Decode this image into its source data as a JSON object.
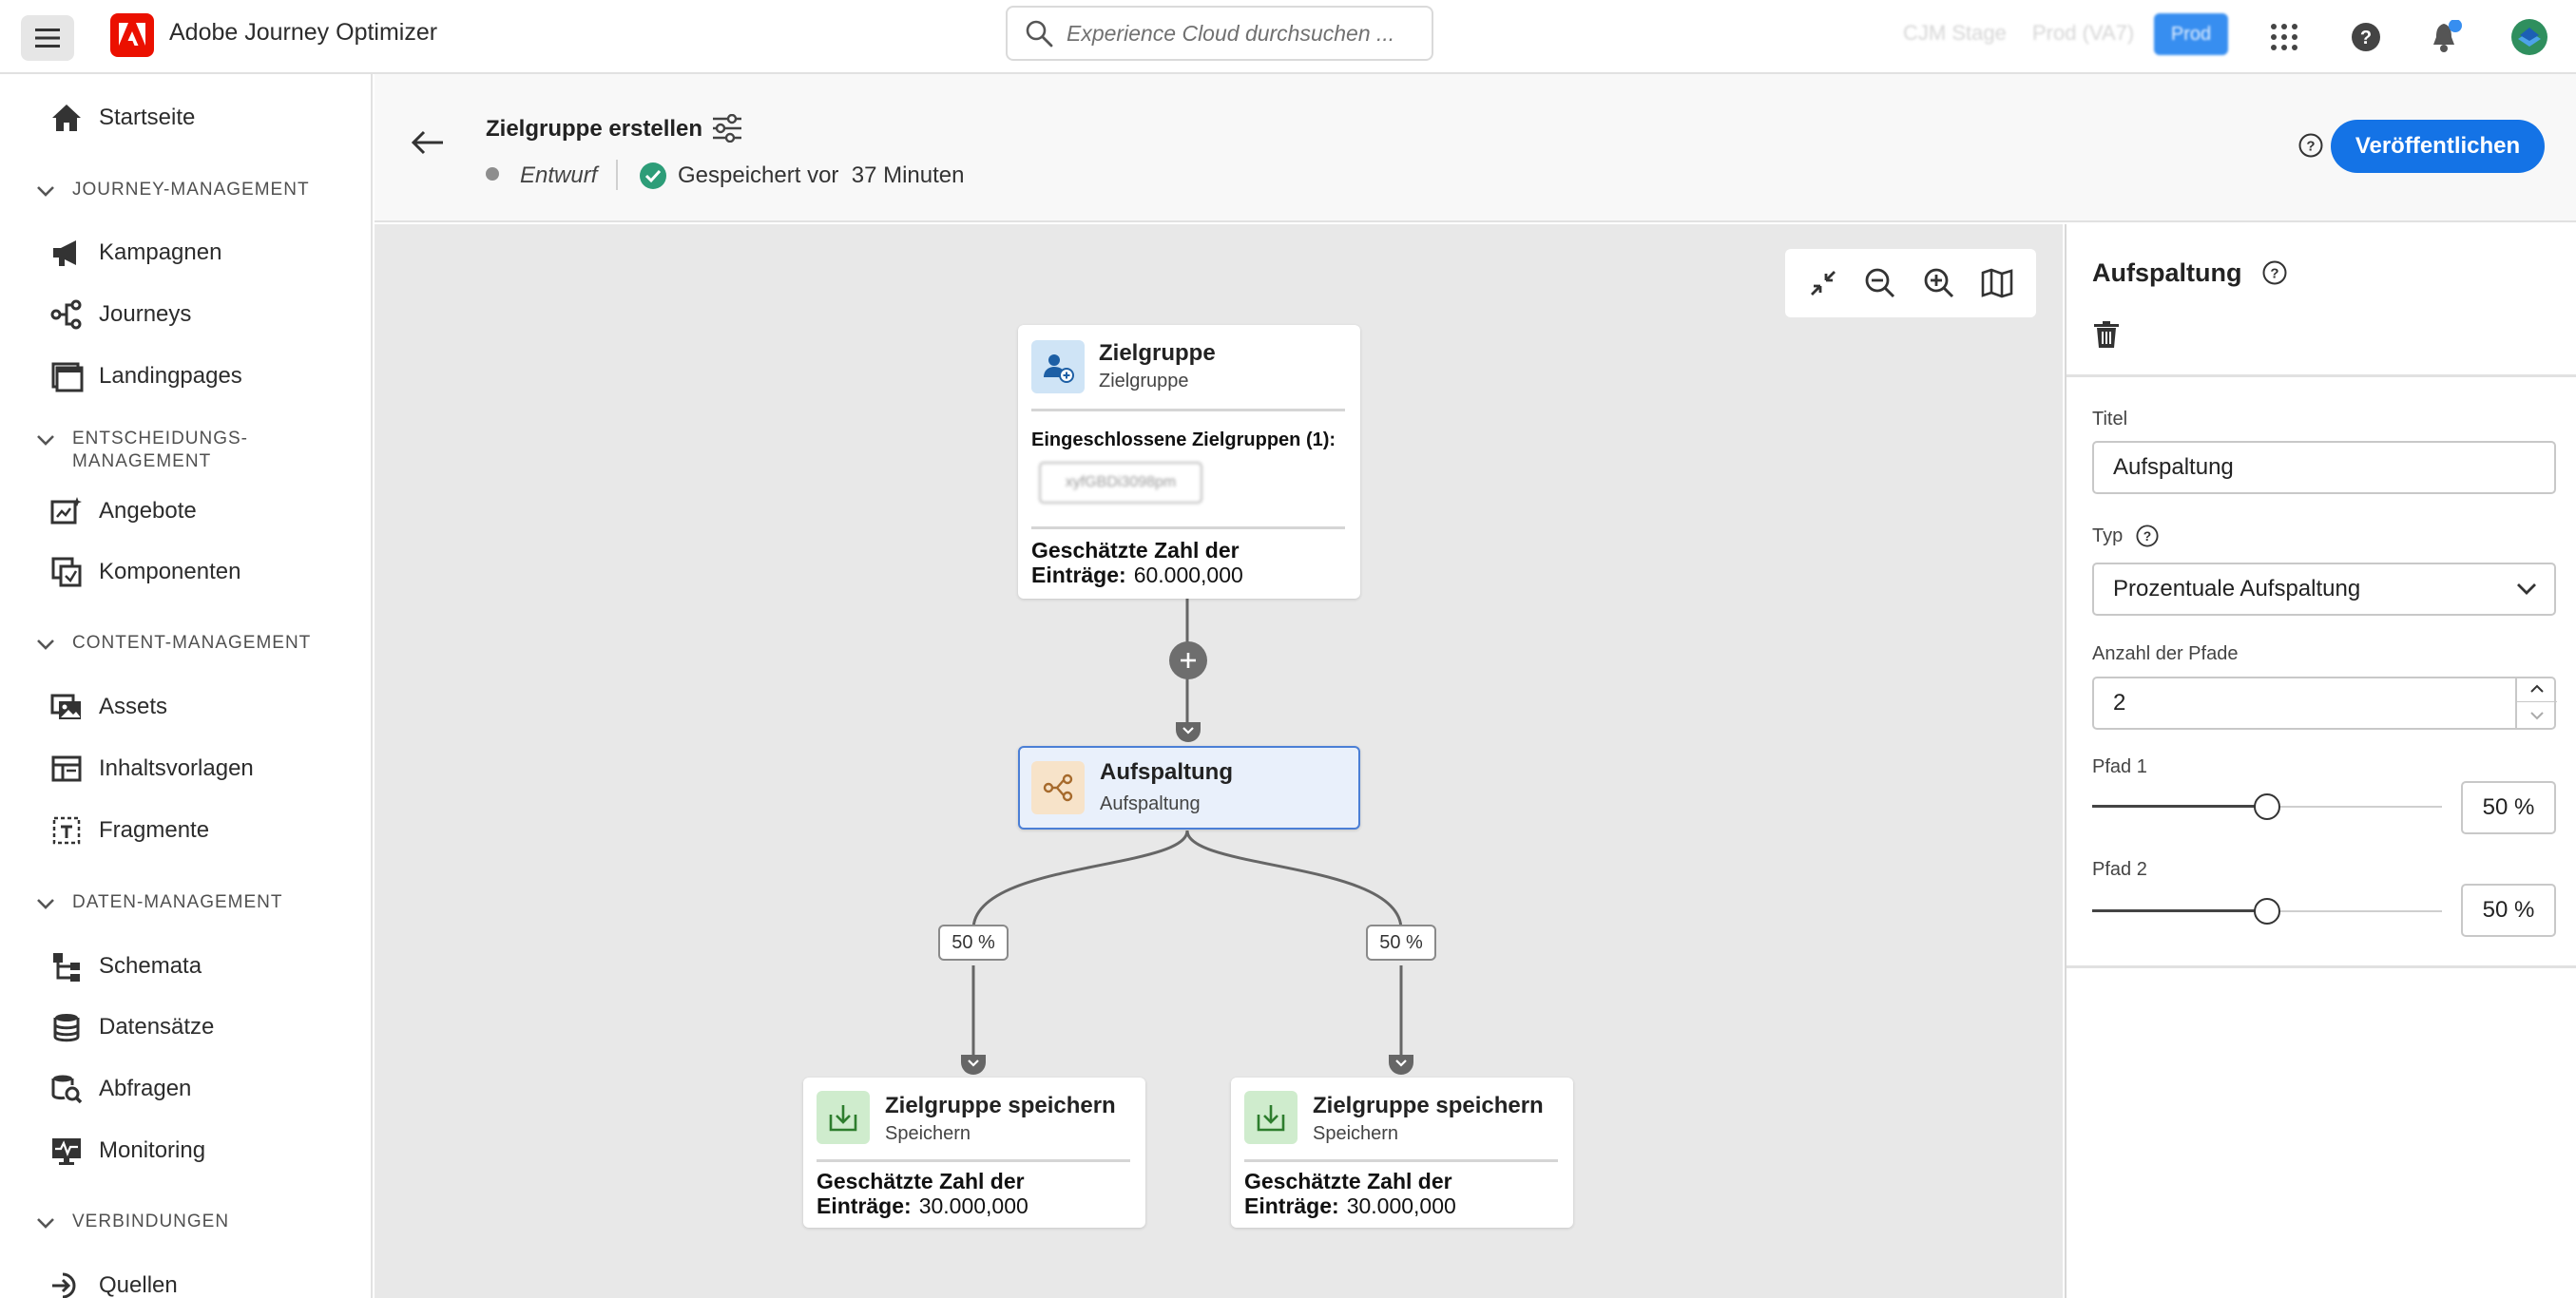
{
  "app": {
    "title": "Adobe Journey Optimizer",
    "search_placeholder": "Experience Cloud durchsuchen ...",
    "env_labels": [
      "CJM Stage",
      "Prod (VA7)",
      "Prod"
    ],
    "icons": [
      "menu-icon",
      "adobe-logo",
      "search-icon",
      "apps-grid-icon",
      "help-icon",
      "bell-icon",
      "avatar"
    ]
  },
  "sidebar": {
    "items": [
      {
        "label": "Startseite",
        "icon": "home-icon"
      },
      {
        "section": "JOURNEY-MANAGEMENT"
      },
      {
        "label": "Kampagnen",
        "icon": "megaphone-icon"
      },
      {
        "label": "Journeys",
        "icon": "journey-icon"
      },
      {
        "label": "Landingpages",
        "icon": "landing-page-icon"
      },
      {
        "section": "ENTSCHEIDUNGS-MANAGEMENT"
      },
      {
        "label": "Angebote",
        "icon": "offers-icon"
      },
      {
        "label": "Komponenten",
        "icon": "components-icon"
      },
      {
        "section": "CONTENT-MANAGEMENT"
      },
      {
        "label": "Assets",
        "icon": "assets-icon"
      },
      {
        "label": "Inhaltsvorlagen",
        "icon": "templates-icon"
      },
      {
        "label": "Fragmente",
        "icon": "fragments-icon"
      },
      {
        "section": "DATEN-MANAGEMENT"
      },
      {
        "label": "Schemata",
        "icon": "schema-icon"
      },
      {
        "label": "Datensätze",
        "icon": "datasets-icon"
      },
      {
        "label": "Abfragen",
        "icon": "queries-icon"
      },
      {
        "label": "Monitoring",
        "icon": "monitoring-icon"
      },
      {
        "section": "VERBINDUNGEN"
      },
      {
        "label": "Quellen",
        "icon": "sources-icon"
      }
    ],
    "section_lines": {
      "entscheidung": [
        "ENTSCHEIDUNGS-",
        "MANAGEMENT"
      ]
    }
  },
  "header": {
    "title": "Zielgruppe erstellen",
    "status": "Entwurf",
    "saved": "Gespeichert vor  37 Minuten",
    "publish_label": "Veröffentlichen"
  },
  "canvas": {
    "audience_node": {
      "title": "Zielgruppe",
      "subtitle": "Zielgruppe",
      "included_label": "Eingeschlossene Zielgruppen (1):",
      "chip": "xyfGBDi3098pm",
      "est_label_1": "Geschätzte Zahl der",
      "est_label_2": "Einträge:",
      "est_value": "60.000,000"
    },
    "split_node": {
      "title": "Aufspaltung",
      "subtitle": "Aufspaltung"
    },
    "branch_labels": [
      "50 %",
      "50 %"
    ],
    "save_nodes": [
      {
        "title": "Zielgruppe speichern",
        "subtitle": "Speichern",
        "est_label_1": "Geschätzte Zahl der",
        "est_label_2": "Einträge:",
        "est_value": "30.000,000"
      },
      {
        "title": "Zielgruppe speichern",
        "subtitle": "Speichern",
        "est_label_1": "Geschätzte Zahl der",
        "est_label_2": "Einträge:",
        "est_value": "30.000,000"
      }
    ]
  },
  "panel": {
    "title": "Aufspaltung",
    "titel_label": "Titel",
    "titel_value": "Aufspaltung",
    "typ_label": "Typ",
    "typ_value": "Prozentuale Aufspaltung",
    "anzahl_label": "Anzahl der Pfade",
    "anzahl_value": "2",
    "paths": [
      {
        "label": "Pfad 1",
        "value": "50 %",
        "fraction": 0.5
      },
      {
        "label": "Pfad 2",
        "value": "50 %",
        "fraction": 0.5
      }
    ]
  },
  "colors": {
    "accent": "#1473e6",
    "adobe_red": "#eb1000",
    "saved_green": "#2d9d78",
    "split_selected_bg": "#e9f0fb",
    "split_selected_border": "#4b7fd6"
  }
}
